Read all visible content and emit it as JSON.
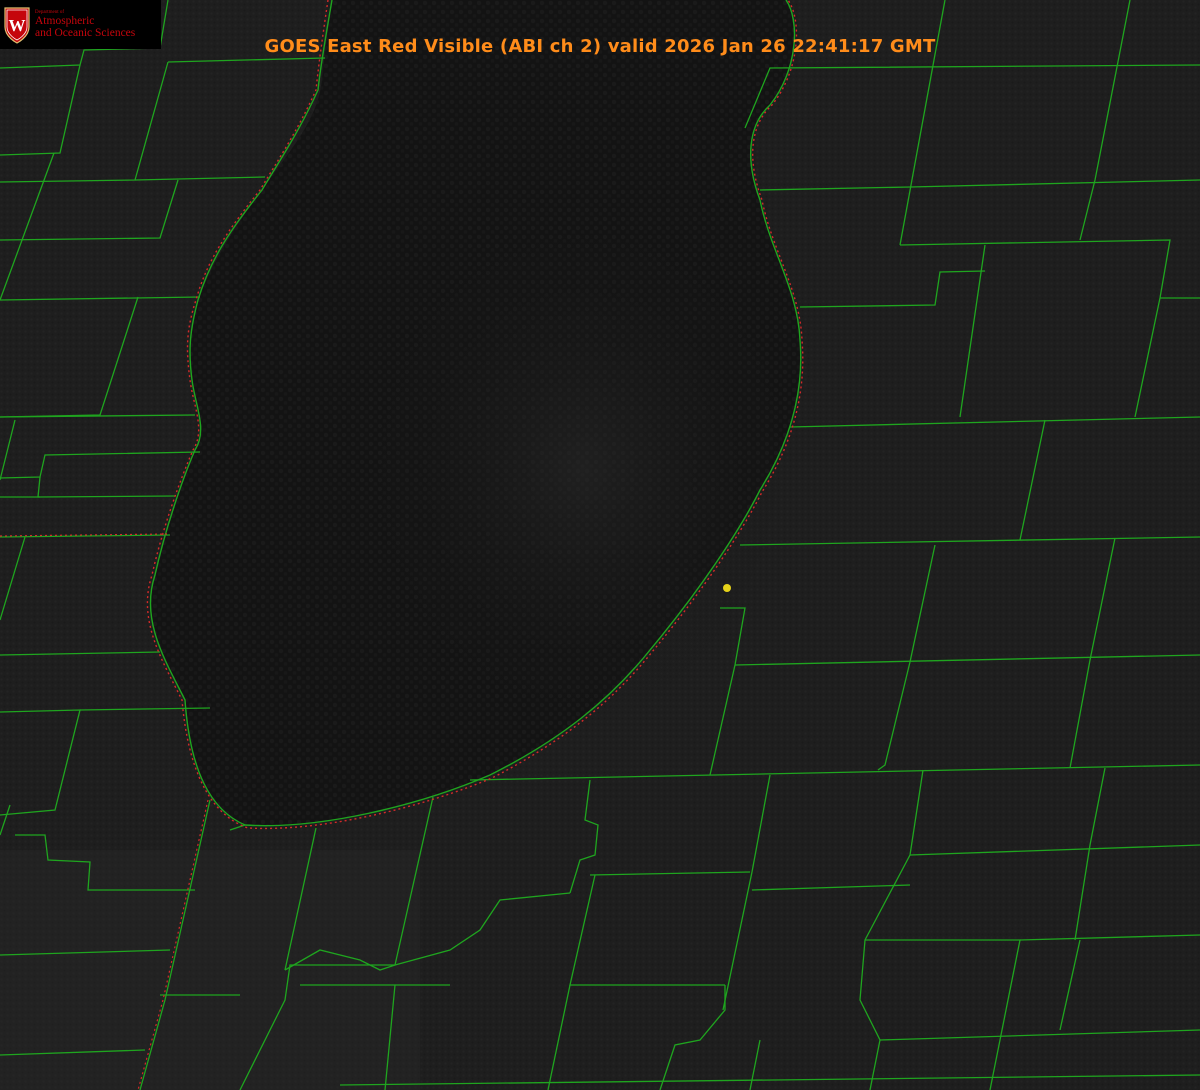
{
  "title": "GOES East Red Visible (ABI ch 2) valid 2026 Jan 26 22:41:17 GMT",
  "logo": {
    "dept": "Department of",
    "line1": "Atmospheric",
    "line2": "and Oceanic Sciences",
    "crest_letter": "W"
  },
  "colors": {
    "background": "#1e1e1e",
    "lake": "#131313",
    "county_lines": "#1fa51f",
    "coastline_dotted": "#d42a2a",
    "title": "#ff8c1a",
    "station_marker": "#e6d21a"
  }
}
